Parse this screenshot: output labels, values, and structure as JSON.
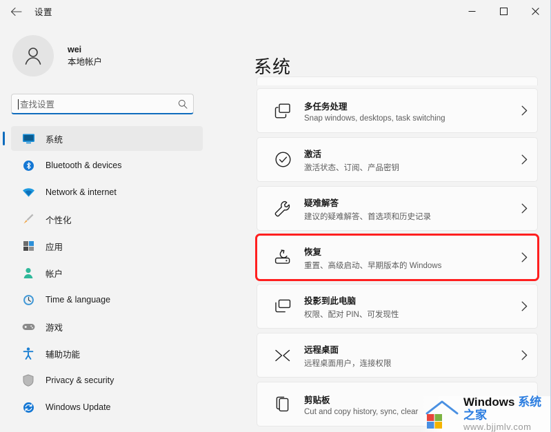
{
  "window": {
    "title": "设置",
    "back_label": "back-arrow",
    "minimize_label": "—",
    "maximize_label": "□",
    "close_label": "✕"
  },
  "account": {
    "name": "wei",
    "type": "本地帐户"
  },
  "search": {
    "placeholder": "查找设置",
    "value": ""
  },
  "sidebar": {
    "items": [
      {
        "label": "系统",
        "icon": "monitor-icon",
        "selected": true
      },
      {
        "label": "Bluetooth & devices",
        "icon": "bluetooth-icon",
        "selected": false
      },
      {
        "label": "Network & internet",
        "icon": "wifi-icon",
        "selected": false
      },
      {
        "label": "个性化",
        "icon": "paintbrush-icon",
        "selected": false
      },
      {
        "label": "应用",
        "icon": "apps-icon",
        "selected": false
      },
      {
        "label": "帐户",
        "icon": "person-icon",
        "selected": false
      },
      {
        "label": "Time & language",
        "icon": "clock-icon",
        "selected": false
      },
      {
        "label": "游戏",
        "icon": "gamepad-icon",
        "selected": false
      },
      {
        "label": "辅助功能",
        "icon": "accessibility-icon",
        "selected": false
      },
      {
        "label": "Privacy & security",
        "icon": "shield-icon",
        "selected": false
      },
      {
        "label": "Windows Update",
        "icon": "update-icon",
        "selected": false
      }
    ]
  },
  "main": {
    "page_title": "系统",
    "cards": [
      {
        "title": "多任务处理",
        "subtitle": "Snap windows, desktops, task switching",
        "icon": "multitasking-icon",
        "highlighted": false
      },
      {
        "title": "激活",
        "subtitle": "激活状态、订阅、产品密钥",
        "icon": "check-circle-icon",
        "highlighted": false
      },
      {
        "title": "疑难解答",
        "subtitle": "建议的疑难解答、首选项和历史记录",
        "icon": "wrench-icon",
        "highlighted": false
      },
      {
        "title": "恢复",
        "subtitle": "重置、高级启动、早期版本的 Windows",
        "icon": "recovery-drive-icon",
        "highlighted": true
      },
      {
        "title": "投影到此电脑",
        "subtitle": "权限、配对 PIN、可发现性",
        "icon": "project-screen-icon",
        "highlighted": false
      },
      {
        "title": "远程桌面",
        "subtitle": "远程桌面用户，连接权限",
        "icon": "remote-desktop-icon",
        "highlighted": false
      },
      {
        "title": "剪贴板",
        "subtitle": "Cut and copy history, sync, clear",
        "icon": "clipboard-icon",
        "highlighted": false
      }
    ]
  },
  "watermark": {
    "line1_en": "Windows ",
    "line1_cn": "系统之家",
    "line2": "www.bjjmlv.com"
  },
  "colors": {
    "accent": "#0f6cbd",
    "highlight": "#ff1f1f",
    "background": "#f3f3f3",
    "card": "#fbfbfb"
  }
}
